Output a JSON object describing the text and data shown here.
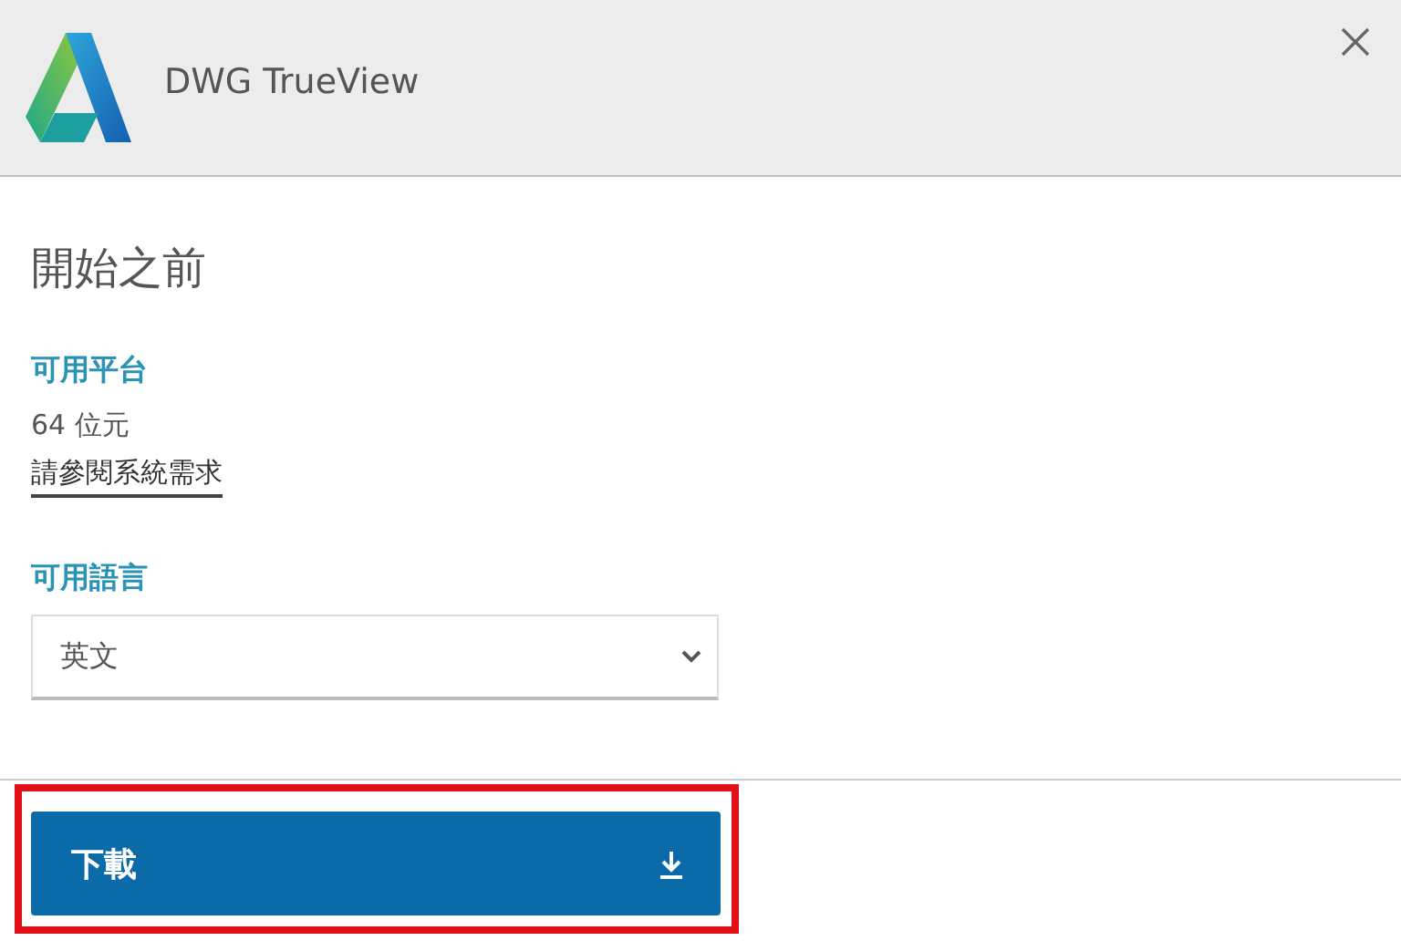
{
  "header": {
    "title": "DWG TrueView"
  },
  "heading": "開始之前",
  "platform": {
    "label": "可用平台",
    "value": "64 位元",
    "link": "請參閱系統需求"
  },
  "language": {
    "label": "可用語言",
    "value": "英文"
  },
  "download_button": {
    "label": "下載",
    "highlighted": true
  }
}
